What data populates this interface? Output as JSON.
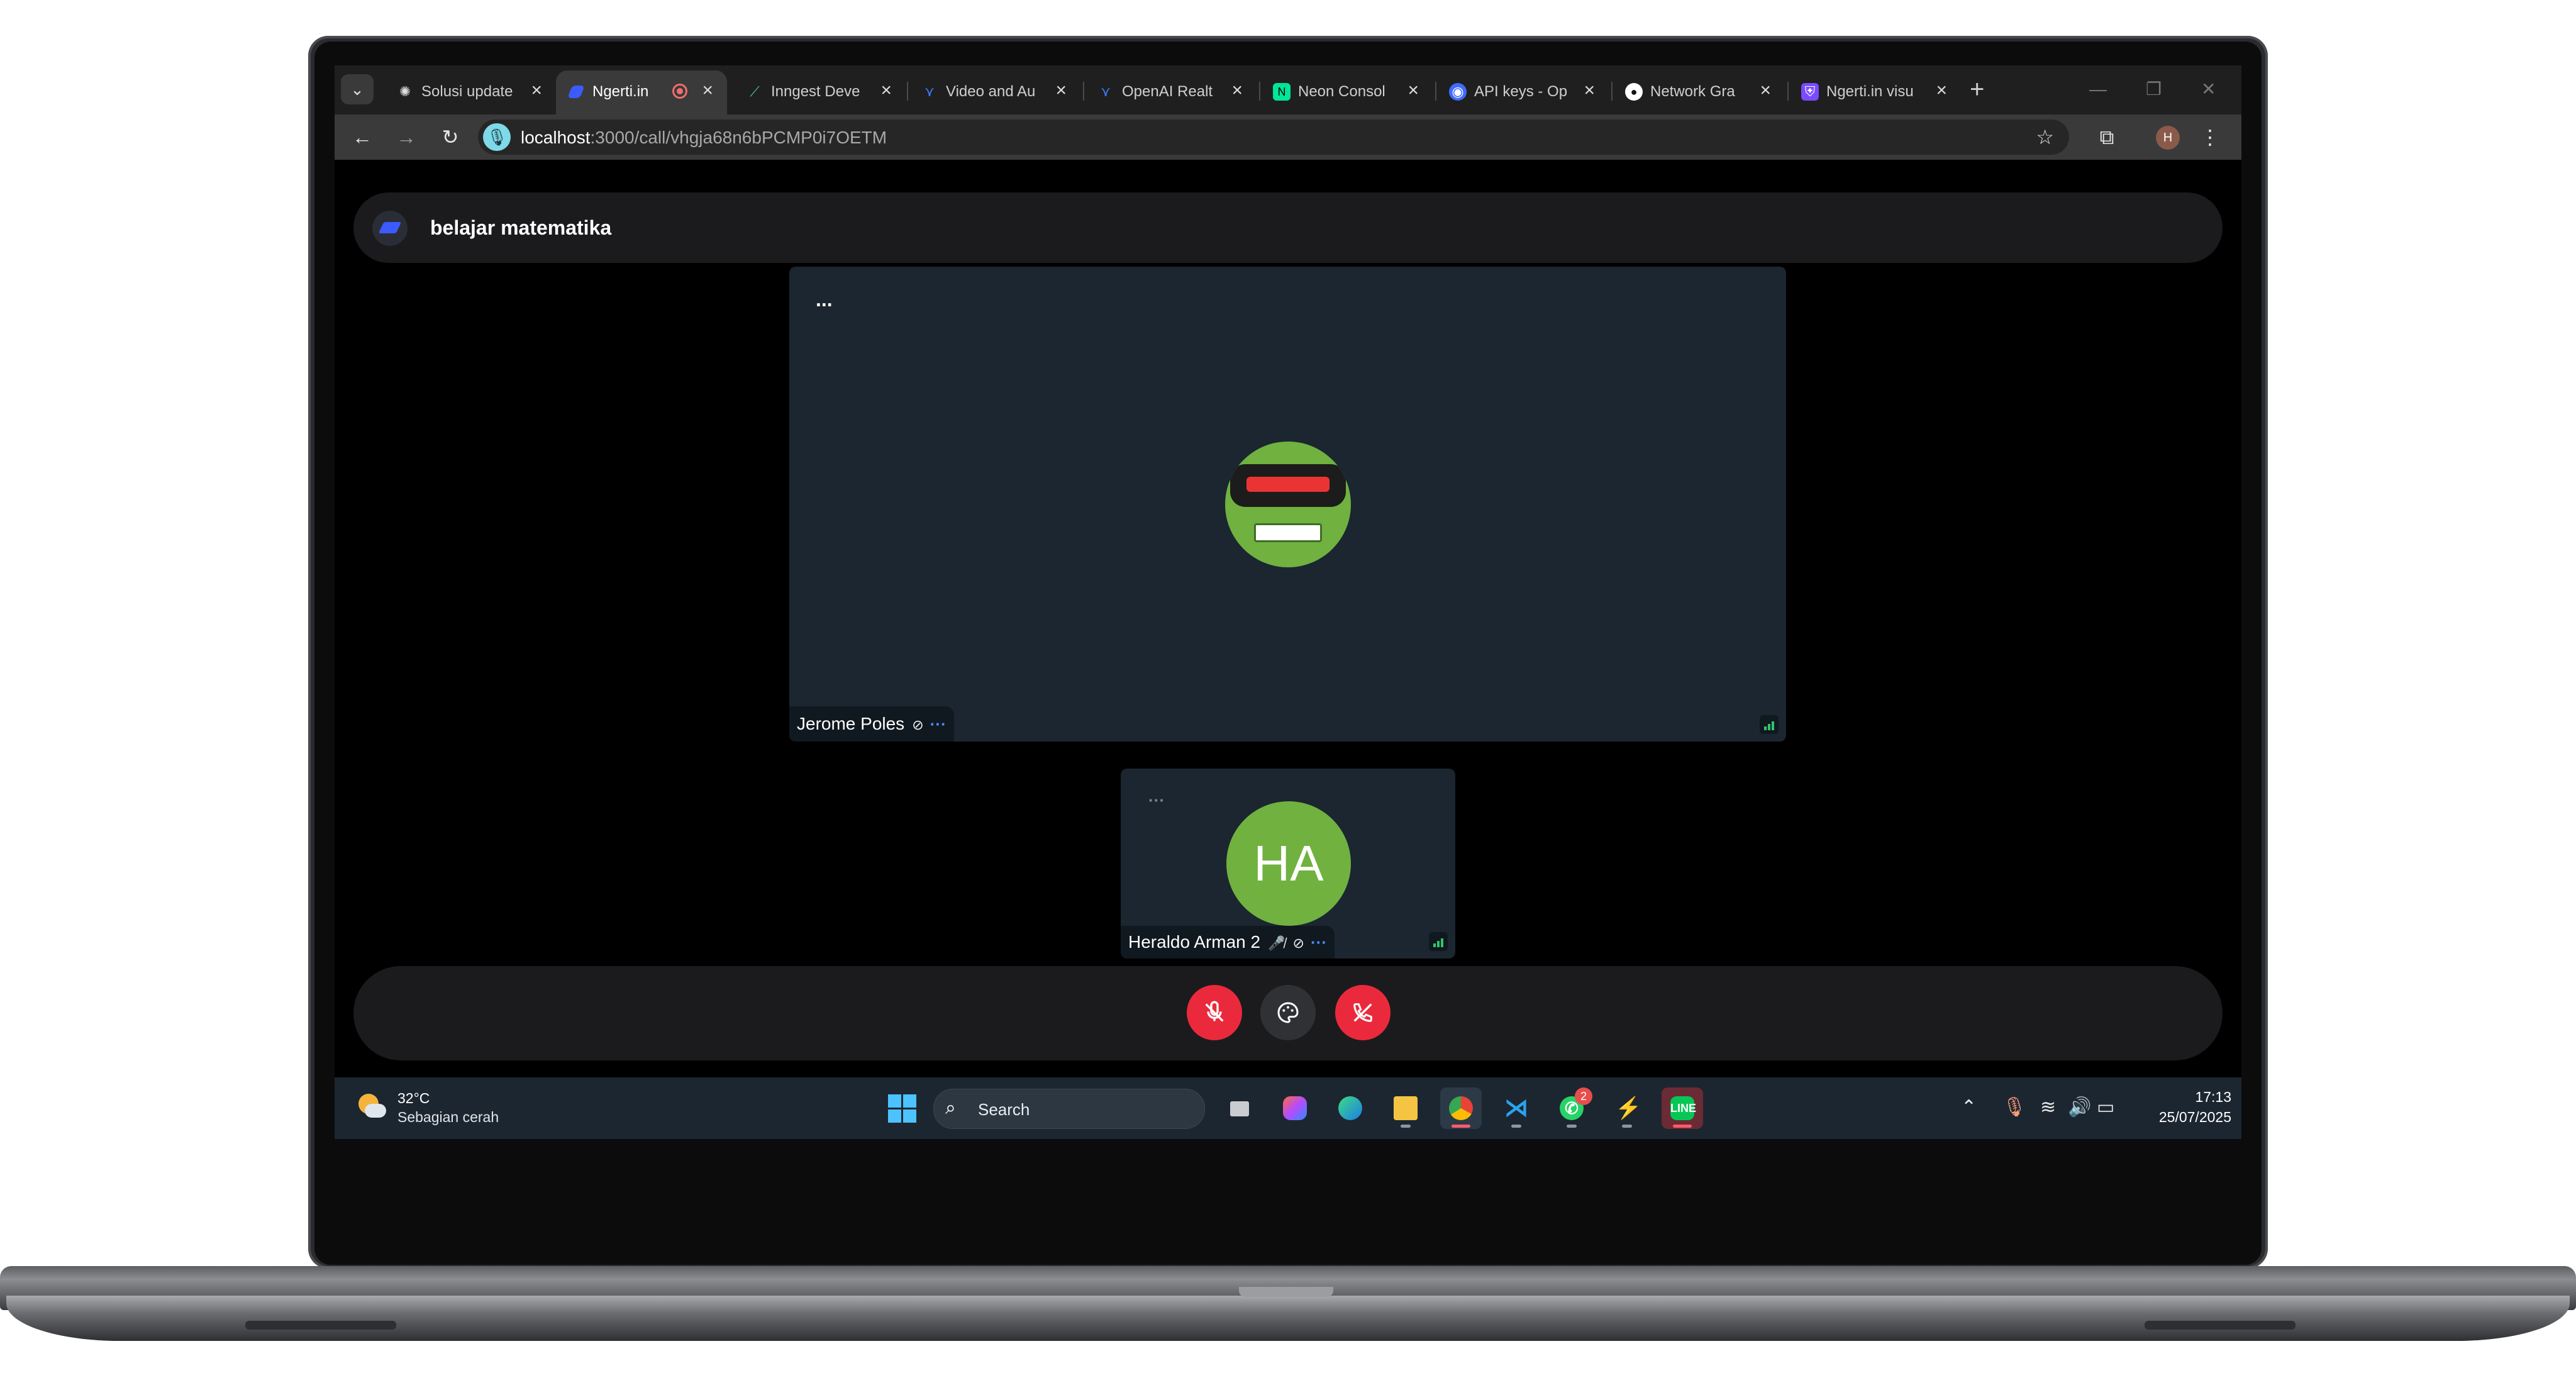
{
  "browser": {
    "tabs": [
      {
        "label": "Solusi update",
        "icon": "openai-icon",
        "active": false
      },
      {
        "label": "Ngerti.in",
        "icon": "ngerti-icon",
        "active": true,
        "recording": true
      },
      {
        "label": "Inngest Deve",
        "icon": "inngest-icon",
        "active": false
      },
      {
        "label": "Video and Au",
        "icon": "stream-icon",
        "active": false
      },
      {
        "label": "OpenAI Realt",
        "icon": "stream-icon",
        "active": false
      },
      {
        "label": "Neon Consol",
        "icon": "neon-icon",
        "active": false
      },
      {
        "label": "API keys - Op",
        "icon": "globe-icon",
        "active": false
      },
      {
        "label": "Network Gra",
        "icon": "github-icon",
        "active": false
      },
      {
        "label": "Ngerti.in visu",
        "icon": "shield-icon",
        "active": false
      }
    ],
    "url_host": "localhost",
    "url_path": ":3000/call/vhgja68n6bPCMP0i7OETM",
    "profile_initial": "H"
  },
  "call": {
    "title": "belajar matematika",
    "main_participant": {
      "name": "Jerome Poles",
      "dots": "...",
      "more": "···"
    },
    "second_participant": {
      "name": "Heraldo Arman 2",
      "initials": "HA",
      "dots": "···",
      "more": "···"
    }
  },
  "taskbar": {
    "weather_temp": "32°C",
    "weather_desc": "Sebagian cerah",
    "search_label": "Search",
    "whatsapp_badge": "2",
    "time": "17:13",
    "date": "25/07/2025"
  },
  "colors": {
    "accent_red": "#ea2a3c",
    "avatar_green": "#70b140",
    "tile_bg": "#1b2630",
    "link_blue": "#4c8dff"
  }
}
